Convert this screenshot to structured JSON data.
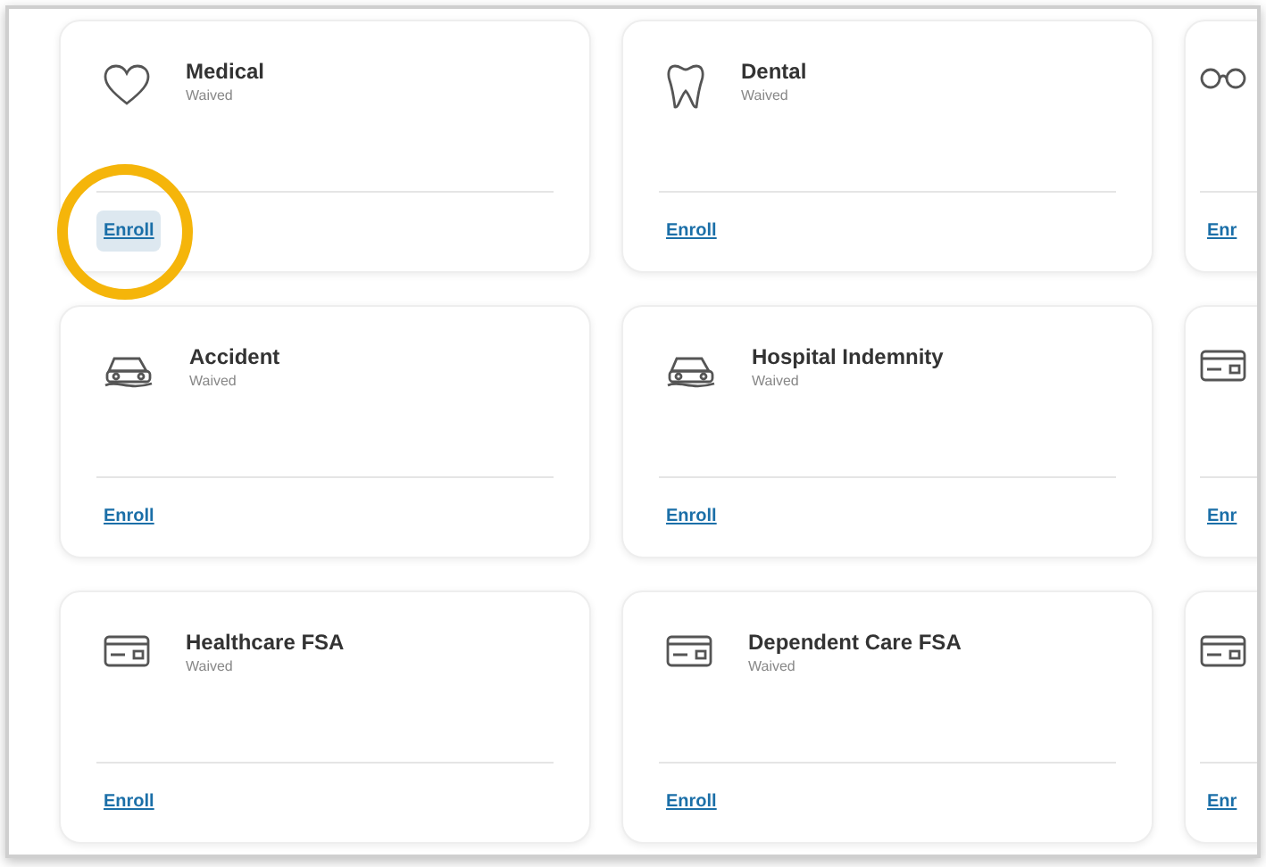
{
  "cards": [
    {
      "kind": "heart",
      "title": "Medical",
      "status": "Waived",
      "action": "Enroll",
      "highlighted": true
    },
    {
      "kind": "tooth",
      "title": "Dental",
      "status": "Waived",
      "action": "Enroll",
      "highlighted": false
    },
    {
      "kind": "glasses",
      "action": "Enr",
      "highlighted": false
    },
    {
      "kind": "car",
      "title": "Accident",
      "status": "Waived",
      "action": "Enroll",
      "highlighted": false
    },
    {
      "kind": "car",
      "title": "Hospital Indemnity",
      "status": "Waived",
      "action": "Enroll",
      "highlighted": false
    },
    {
      "kind": "card",
      "action": "Enr",
      "highlighted": false
    },
    {
      "kind": "card",
      "title": "Healthcare FSA",
      "status": "Waived",
      "action": "Enroll",
      "highlighted": false
    },
    {
      "kind": "card",
      "title": "Dependent Care FSA",
      "status": "Waived",
      "action": "Enroll",
      "highlighted": false
    },
    {
      "kind": "card",
      "action": "Enr",
      "highlighted": false
    }
  ]
}
